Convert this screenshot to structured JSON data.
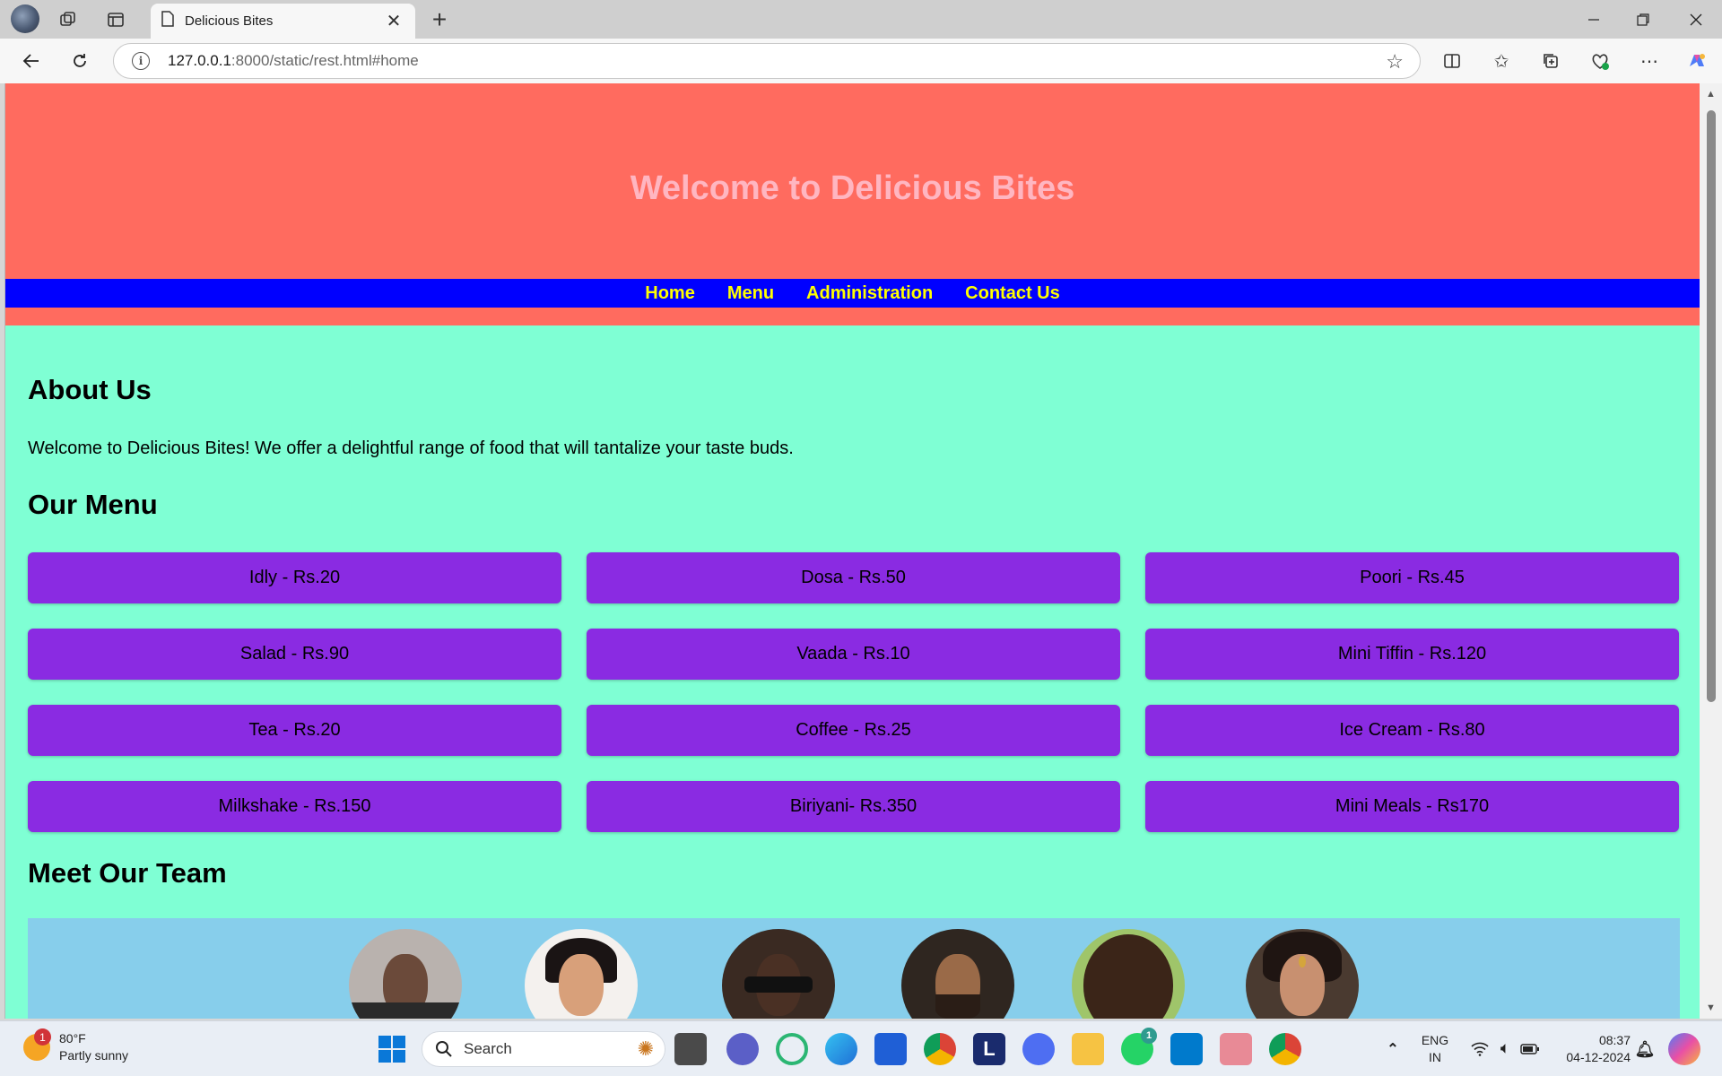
{
  "browser": {
    "tab_title": "Delicious Bites",
    "url_host": "127.0.0.1",
    "url_rest": ":8000/static/rest.html#home"
  },
  "site": {
    "title": "Welcome to Delicious Bites",
    "nav": [
      "Home",
      "Menu",
      "Administration",
      "Contact Us"
    ],
    "about_heading": "About Us",
    "about_text": "Welcome to Delicious Bites! We offer a delightful range of food that will tantalize your taste buds.",
    "menu_heading": "Our Menu",
    "menu_items": [
      "Idly - Rs.20",
      "Dosa - Rs.50",
      "Poori - Rs.45",
      "Salad - Rs.90",
      "Vaada - Rs.10",
      "Mini Tiffin - Rs.120",
      "Tea - Rs.20",
      "Coffee - Rs.25",
      "Ice Cream - Rs.80",
      "Milkshake - Rs.150",
      "Biriyani- Rs.350",
      "Mini Meals - Rs170"
    ],
    "team_heading": "Meet Our Team",
    "team_count": 6
  },
  "taskbar": {
    "weather_badge": "1",
    "weather_temp": "80°F",
    "weather_desc": "Partly sunny",
    "search_label": "Search",
    "whatsapp_badge": "1",
    "lang_top": "ENG",
    "lang_bottom": "IN",
    "time": "08:37",
    "date": "04-12-2024"
  },
  "colors": {
    "header_bg": "#ff6b5f",
    "title_color": "#ffb6c1",
    "nav_bg": "#0000ff",
    "nav_link": "#ffff00",
    "page_bg": "#7fffd4",
    "menu_item_bg": "#8a2be2",
    "team_bg": "#87ceeb"
  }
}
